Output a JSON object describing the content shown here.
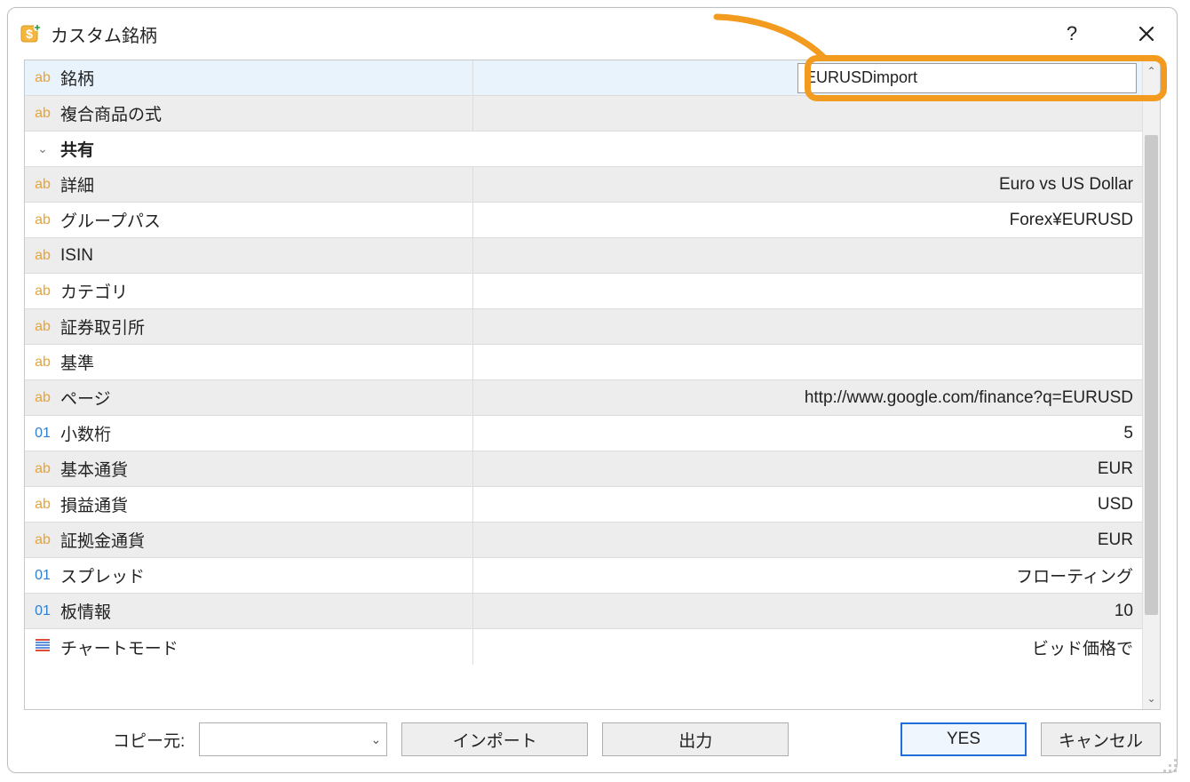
{
  "window": {
    "title": "カスタム銘柄"
  },
  "nameInput": "EURUSDimport",
  "rows": [
    {
      "type": "ab",
      "label": "銘柄",
      "value": "",
      "alt": false,
      "sel": true,
      "input": true
    },
    {
      "type": "ab",
      "label": "複合商品の式",
      "value": "",
      "alt": true
    },
    {
      "type": "group",
      "label": "共有"
    },
    {
      "type": "ab",
      "label": "詳細",
      "value": "Euro vs US Dollar",
      "alt": true
    },
    {
      "type": "ab",
      "label": "グループパス",
      "value": "Forex¥EURUSD",
      "alt": false
    },
    {
      "type": "ab",
      "label": "ISIN",
      "value": "",
      "alt": true
    },
    {
      "type": "ab",
      "label": "カテゴリ",
      "value": "",
      "alt": false
    },
    {
      "type": "ab",
      "label": "証券取引所",
      "value": "",
      "alt": true
    },
    {
      "type": "ab",
      "label": "基準",
      "value": "",
      "alt": false
    },
    {
      "type": "ab",
      "label": "ページ",
      "value": "http://www.google.com/finance?q=EURUSD",
      "alt": true
    },
    {
      "type": "01",
      "label": "小数桁",
      "value": "5",
      "alt": false
    },
    {
      "type": "ab",
      "label": "基本通貨",
      "value": "EUR",
      "alt": true
    },
    {
      "type": "ab",
      "label": "損益通貨",
      "value": "USD",
      "alt": false
    },
    {
      "type": "ab",
      "label": "証拠金通貨",
      "value": "EUR",
      "alt": true
    },
    {
      "type": "01",
      "label": "スプレッド",
      "value": "フローティング",
      "alt": false
    },
    {
      "type": "01",
      "label": "板情報",
      "value": "10",
      "alt": true
    },
    {
      "type": "chart",
      "label": "チャートモード",
      "value": "ビッド価格で",
      "alt": false
    }
  ],
  "bottom": {
    "copyFromLabel": "コピー元:",
    "importLabel": "インポート",
    "exportLabel": "出力",
    "yesLabel": "YES",
    "cancelLabel": "キャンセル"
  }
}
